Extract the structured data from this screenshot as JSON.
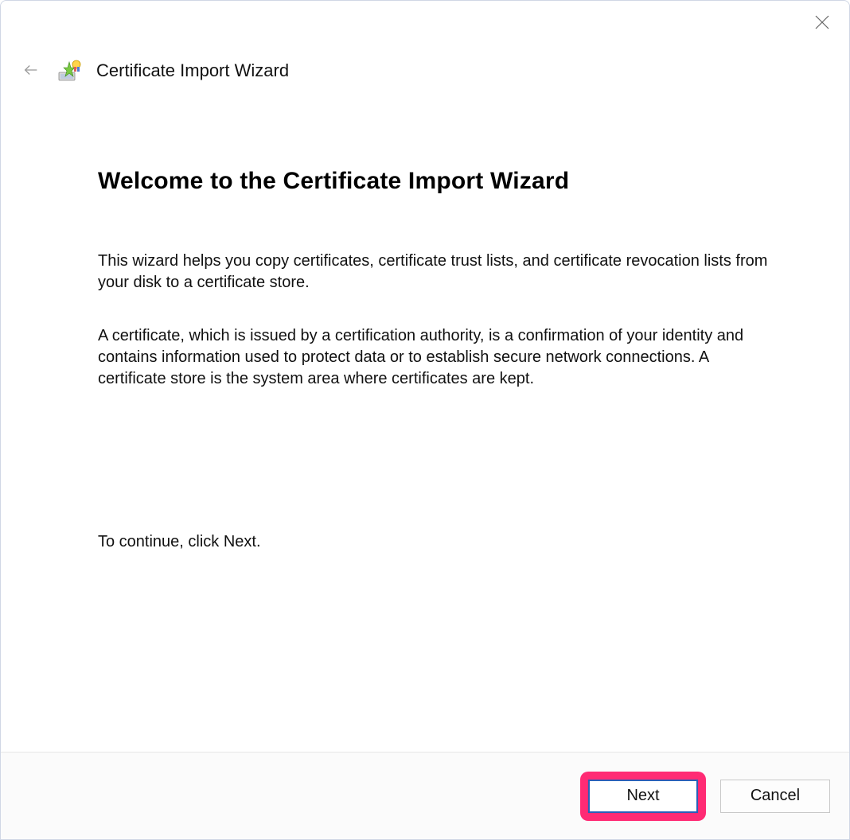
{
  "titlebar": {
    "wizard_title": "Certificate Import Wizard"
  },
  "content": {
    "heading": "Welcome to the Certificate Import Wizard",
    "para1": "This wizard helps you copy certificates, certificate trust lists, and certificate revocation lists from your disk to a certificate store.",
    "para2": "A certificate, which is issued by a certification authority, is a confirmation of your identity and contains information used to protect data or to establish secure network connections. A certificate store is the system area where certificates are kept.",
    "continue_text": "To continue, click Next."
  },
  "footer": {
    "next_label": "Next",
    "cancel_label": "Cancel"
  }
}
